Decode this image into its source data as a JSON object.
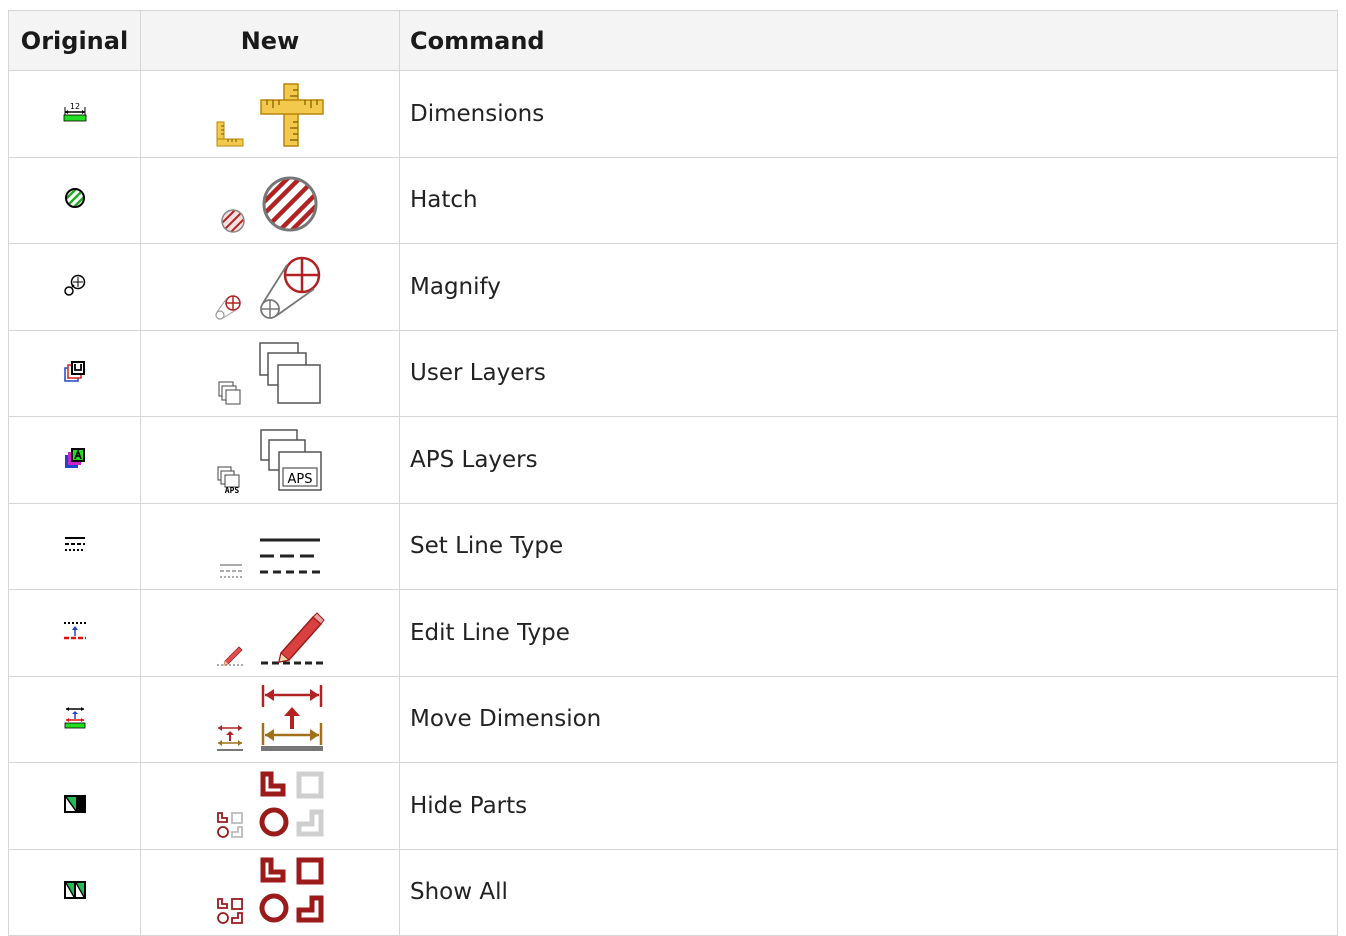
{
  "headers": {
    "original": "Original",
    "new": "New",
    "command": "Command"
  },
  "rows": [
    {
      "command": "Dimensions",
      "icon": "ruler-icon"
    },
    {
      "command": "Hatch",
      "icon": "hatch-icon"
    },
    {
      "command": "Magnify",
      "icon": "magnify-icon"
    },
    {
      "command": "User Layers",
      "icon": "user-layers-icon"
    },
    {
      "command": "APS Layers",
      "icon": "aps-layers-icon"
    },
    {
      "command": "Set Line Type",
      "icon": "set-line-type-icon"
    },
    {
      "command": "Edit Line Type",
      "icon": "edit-line-type-icon"
    },
    {
      "command": "Move Dimension",
      "icon": "move-dimension-icon"
    },
    {
      "command": "Hide Parts",
      "icon": "hide-parts-icon"
    },
    {
      "command": "Show All",
      "icon": "show-all-icon"
    }
  ],
  "aps_label": "APS",
  "orig_dim_label": "12",
  "colors": {
    "header_bg": "#f4f4f4",
    "border": "#d6d6d6",
    "accent_red": "#9b1b1b",
    "ruler_yellow": "#f2c94c"
  }
}
